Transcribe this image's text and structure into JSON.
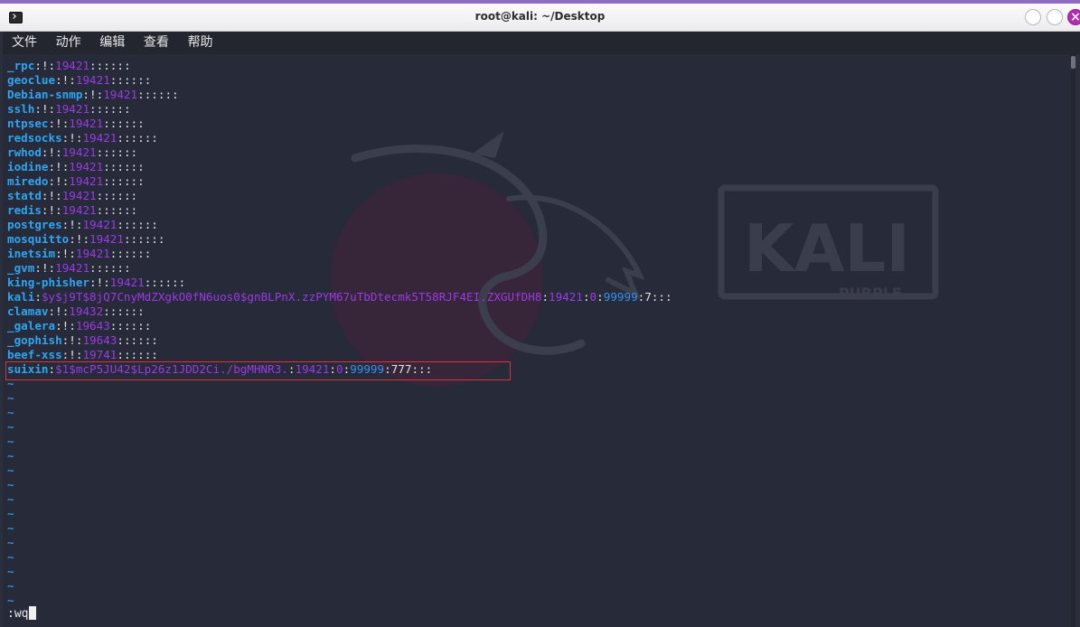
{
  "window": {
    "title": "root@kali: ~/Desktop",
    "close_glyph": "×",
    "accent": "#b22bb3"
  },
  "menu": [
    "文件",
    "动作",
    "编辑",
    "查看",
    "帮助"
  ],
  "shadow_lines": [
    {
      "user": "_rpc",
      "pw": "!",
      "d": "19421",
      "rest": "::::::"
    },
    {
      "user": "geoclue",
      "pw": "!",
      "d": "19421",
      "rest": "::::::"
    },
    {
      "user": "Debian-snmp",
      "pw": "!",
      "d": "19421",
      "rest": "::::::"
    },
    {
      "user": "sslh",
      "pw": "!",
      "d": "19421",
      "rest": "::::::"
    },
    {
      "user": "ntpsec",
      "pw": "!",
      "d": "19421",
      "rest": "::::::"
    },
    {
      "user": "redsocks",
      "pw": "!",
      "d": "19421",
      "rest": "::::::"
    },
    {
      "user": "rwhod",
      "pw": "!",
      "d": "19421",
      "rest": "::::::"
    },
    {
      "user": "iodine",
      "pw": "!",
      "d": "19421",
      "rest": "::::::"
    },
    {
      "user": "miredo",
      "pw": "!",
      "d": "19421",
      "rest": "::::::"
    },
    {
      "user": "statd",
      "pw": "!",
      "d": "19421",
      "rest": "::::::"
    },
    {
      "user": "redis",
      "pw": "!",
      "d": "19421",
      "rest": "::::::"
    },
    {
      "user": "postgres",
      "pw": "!",
      "d": "19421",
      "rest": "::::::"
    },
    {
      "user": "mosquitto",
      "pw": "!",
      "d": "19421",
      "rest": "::::::"
    },
    {
      "user": "inetsim",
      "pw": "!",
      "d": "19421",
      "rest": "::::::"
    },
    {
      "user": "_gvm",
      "pw": "!",
      "d": "19421",
      "rest": "::::::"
    },
    {
      "user": "king-phisher",
      "pw": "!",
      "d": "19421",
      "rest": "::::::"
    },
    {
      "user": "kali",
      "hash": "$y$j9T$8jQ7CnyMdZXgkO0fN6uos0$gnBLPnX.zzPYM67uTbDtecmk5T58RJF4EI.ZXGUfDH8",
      "d": "19421",
      "min": "0",
      "max": "99999",
      "warn": "7",
      "tail": ":::"
    },
    {
      "user": "clamav",
      "pw": "!",
      "d": "19432",
      "rest": "::::::"
    },
    {
      "user": "_galera",
      "pw": "!",
      "d": "19643",
      "rest": "::::::"
    },
    {
      "user": "_gophish",
      "pw": "!",
      "d": "19643",
      "rest": "::::::"
    },
    {
      "user": "beef-xss",
      "pw": "!",
      "d": "19741",
      "rest": "::::::"
    },
    {
      "user": "suixin",
      "hash": "$1$mcP5JU42$Lp26z1JDD2Ci./bgMHNR3.",
      "d": "19421",
      "min": "0",
      "max": "99999",
      "warn": "777",
      "tail": ":::"
    }
  ],
  "empty_marker": "~",
  "empty_count": 16,
  "command": ":wq",
  "wallpaper": {
    "logo_text": "KALI",
    "logo_subtext": "PURPLE"
  }
}
